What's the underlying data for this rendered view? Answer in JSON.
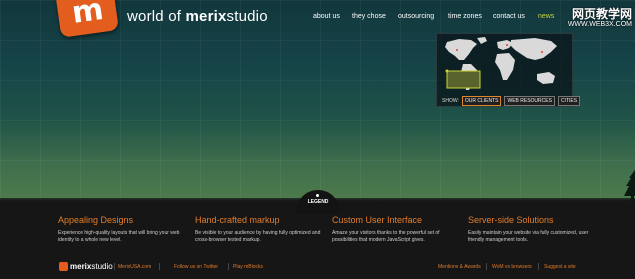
{
  "header": {
    "logo_glyph": "m",
    "title_prefix": "world of ",
    "title_bold": "merix",
    "title_suffix": "studio",
    "accent_color": "#e25d1e"
  },
  "nav": {
    "items": [
      "about us",
      "they chose",
      "outsourcing",
      "time zones",
      "contact us",
      "news"
    ]
  },
  "watermark": {
    "line1": "网页教学网",
    "line2": "WWW.WEB3X.COM"
  },
  "map": {
    "show_label": "SHOW:",
    "tabs": [
      "OUR CLIENTS",
      "WEB RESOURCES",
      "CITIES"
    ],
    "active_tab": "OUR CLIENTS"
  },
  "legend": {
    "label": "LEGEND"
  },
  "features": [
    {
      "title": "Appealing Designs",
      "text": "Experience high-quality layouts that will bring your web identity to a whole new level."
    },
    {
      "title": "Hand-crafted markup",
      "text": "Be visible to your audience by having fully optimized and cross-browser tested markup."
    },
    {
      "title": "Custom User Interface",
      "text": "Amaze your visitors thanks to the powerful set of possibilities that modern JavaScript gives."
    },
    {
      "title": "Server-side Solutions",
      "text": "Easily maintain your website via fully customized, user friendly management tools."
    }
  ],
  "footer": {
    "title_bold": "merix",
    "title_suffix": "studio",
    "links_left": [
      "MerixUSA.com",
      "Follow us on Twitter",
      "Play mBlocks"
    ],
    "links_right": [
      "Mentions & Awards",
      "WoM vs browsers",
      "Suggest a site"
    ]
  }
}
